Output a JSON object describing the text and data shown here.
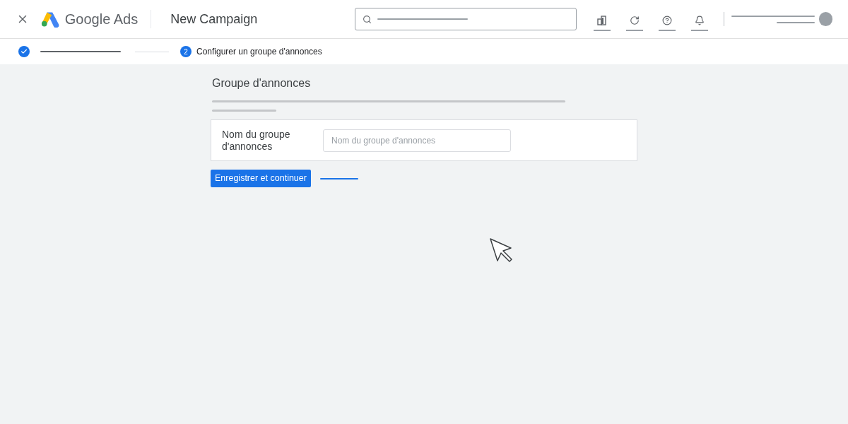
{
  "header": {
    "brand": "Google Ads",
    "title": "New Campaign"
  },
  "steps": [
    {
      "kind": "done"
    },
    {
      "kind": "current",
      "number": "2",
      "label": "Configurer un groupe d'annonces"
    }
  ],
  "section": {
    "title": "Groupe d'annonces"
  },
  "form": {
    "label": "Nom du groupe d'annonces",
    "placeholder": "Nom du groupe d'annonces"
  },
  "buttons": [
    "Enregistrer et continuer"
  ]
}
